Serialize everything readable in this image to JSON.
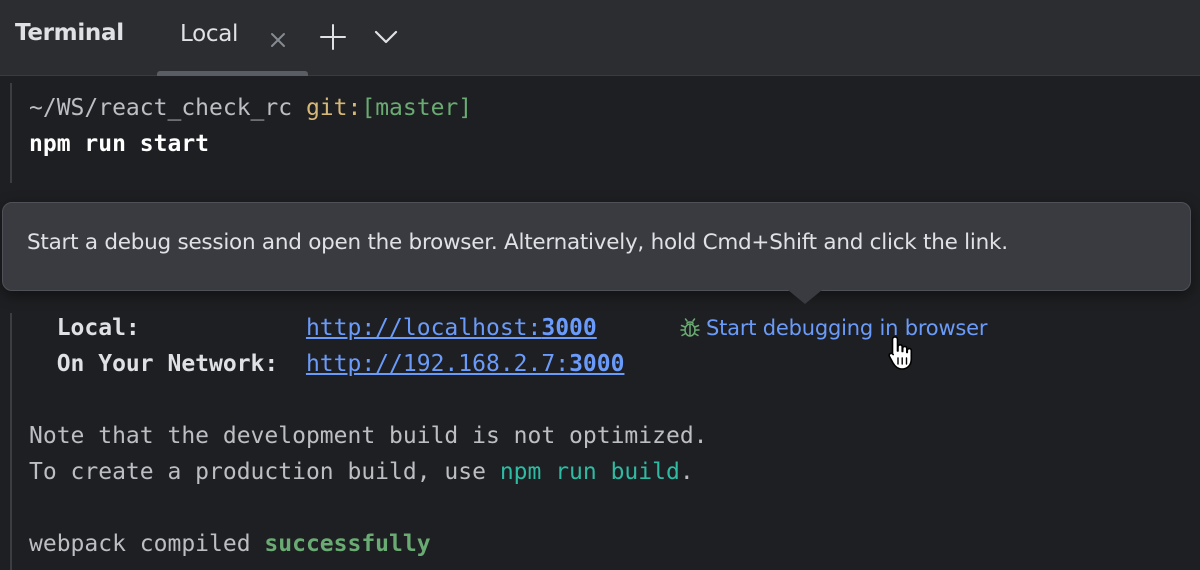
{
  "toolwindow": {
    "title": "Terminal",
    "tab_label": "Local"
  },
  "icons": {
    "close": "close-icon",
    "add": "plus-icon",
    "dropdown": "chevron-down-icon",
    "bug": "bug-icon",
    "cursor": "hand-pointer-cursor"
  },
  "terminal": {
    "prompt": {
      "cwd": "~/WS/react_check_rc ",
      "git_label": "git:",
      "git_branch": "[master]"
    },
    "command": "npm run start",
    "local_label": "  Local:            ",
    "local_url_host": "http://localhost:",
    "local_url_port": "3000",
    "network_label": "  On Your Network:  ",
    "network_url_host": "http://192.168.2.7:",
    "network_url_port": "3000",
    "debug_link": "Start debugging in browser",
    "note_line": "Note that the development build is not optimized.",
    "prod_prefix": "To create a production build, use ",
    "prod_cmd": "npm run build",
    "prod_suffix": ".",
    "webpack_prefix": "webpack compiled ",
    "webpack_status": "successfully"
  },
  "tooltip": {
    "text": "Start a debug session and open the browser. Alternatively, hold Cmd+Shift and click the link."
  },
  "colors": {
    "background": "#1e1f22",
    "header": "#2b2d30",
    "link": "#6b9bfa",
    "git_label": "#d5b778",
    "git_branch": "#6aab73",
    "success": "#6aab73",
    "command_highlight": "#2fbaa3",
    "tooltip_bg": "#393b40"
  }
}
